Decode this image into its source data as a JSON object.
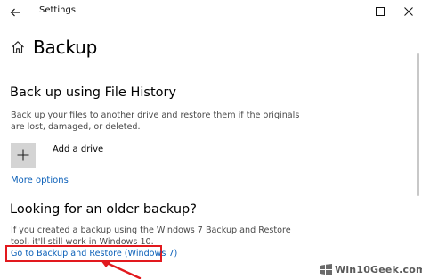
{
  "window": {
    "title": "Settings",
    "controls": {
      "minimize": "minimize-icon",
      "maximize": "maximize-icon",
      "close": "close-icon"
    }
  },
  "page": {
    "title": "Backup",
    "icon": "home-icon"
  },
  "file_history": {
    "heading": "Back up using File History",
    "description": "Back up your files to another drive and restore them if the originals are lost, damaged, or deleted.",
    "add_drive_label": "Add a drive",
    "more_options_label": "More options"
  },
  "older_backup": {
    "heading": "Looking for an older backup?",
    "description": "If you created a backup using the Windows 7 Backup and Restore tool, it'll still work in Windows 10.",
    "link_label": "Go to Backup and Restore (Windows 7)"
  },
  "annotation": {
    "highlight_color": "#e2191e"
  },
  "watermark": {
    "text": "Win10Geek.com"
  },
  "colors": {
    "link": "#0a5fb8",
    "tile": "#d4d4d4"
  }
}
